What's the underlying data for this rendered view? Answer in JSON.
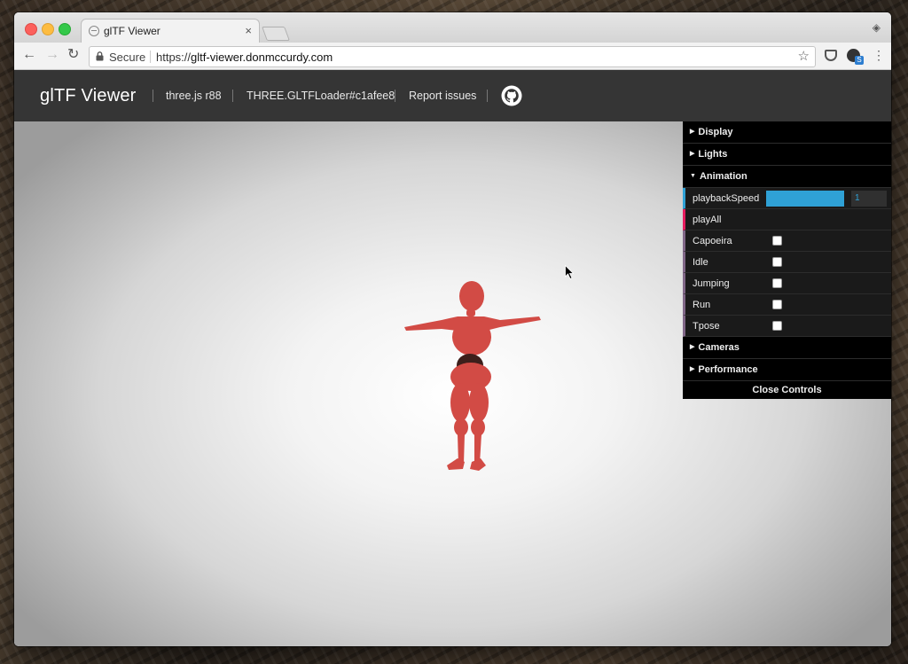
{
  "browser": {
    "tab_title": "glTF Viewer",
    "tab_close": "×",
    "secure_label": "Secure",
    "url_scheme": "https://",
    "url_host": "gltf-viewer.donmccurdy.com"
  },
  "app": {
    "title": "glTF Viewer",
    "links": [
      "three.js r88",
      "THREE.GLTFLoader#c1afee8",
      "Report issues"
    ],
    "figure_color": "#d24b45"
  },
  "controls": {
    "folders_top": [
      {
        "label": "Display",
        "open": false
      },
      {
        "label": "Lights",
        "open": false
      },
      {
        "label": "Animation",
        "open": true
      }
    ],
    "playback": {
      "label": "playbackSpeed",
      "value": "1",
      "fill_fraction": 1.0
    },
    "play_all": {
      "label": "playAll"
    },
    "clips": [
      {
        "label": "Capoeira",
        "checked": false
      },
      {
        "label": "Idle",
        "checked": false
      },
      {
        "label": "Jumping",
        "checked": false
      },
      {
        "label": "Run",
        "checked": false
      },
      {
        "label": "Tpose",
        "checked": false
      }
    ],
    "folders_bottom": [
      {
        "label": "Cameras",
        "open": false
      },
      {
        "label": "Performance",
        "open": false
      }
    ],
    "close_label": "Close Controls"
  }
}
